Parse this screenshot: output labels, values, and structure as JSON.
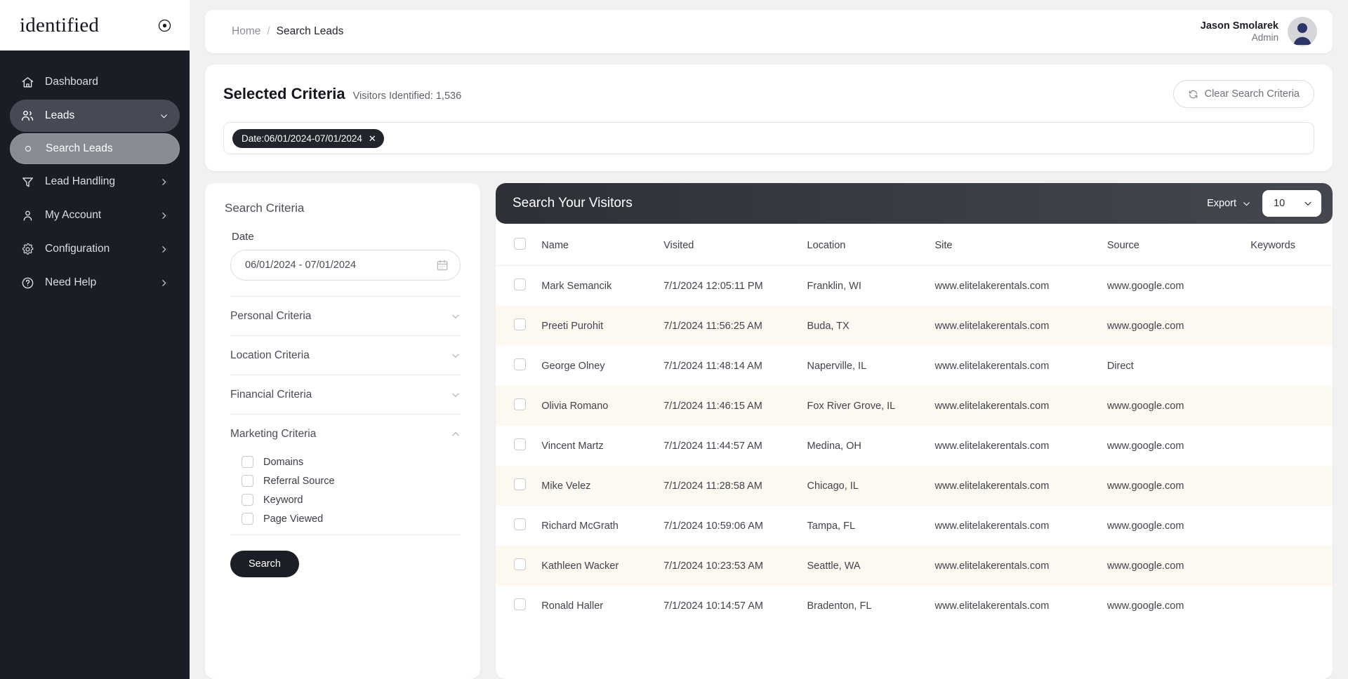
{
  "brand": {
    "name": "identified",
    "mark_icon": "circle-dot-icon"
  },
  "sidebar": {
    "items": [
      {
        "label": "Dashboard",
        "icon": "home-icon",
        "state": "default",
        "chevron": ""
      },
      {
        "label": "Leads",
        "icon": "users-icon",
        "state": "active-parent",
        "chevron": "chevron-down-icon"
      },
      {
        "label": "Search Leads",
        "icon": "bullet-icon",
        "state": "active-child",
        "chevron": ""
      },
      {
        "label": "Lead Handling",
        "icon": "funnel-icon",
        "state": "default",
        "chevron": "chevron-right-icon"
      },
      {
        "label": "My Account",
        "icon": "user-icon",
        "state": "default",
        "chevron": "chevron-right-icon"
      },
      {
        "label": "Configuration",
        "icon": "gear-icon",
        "state": "default",
        "chevron": "chevron-right-icon"
      },
      {
        "label": "Need Help",
        "icon": "help-circle-icon",
        "state": "default",
        "chevron": "chevron-right-icon"
      }
    ]
  },
  "topbar": {
    "breadcrumb_home": "Home",
    "breadcrumb_sep": "/",
    "breadcrumb_current": "Search Leads",
    "user_name": "Jason Smolarek",
    "user_role": "Admin"
  },
  "criteria": {
    "title": "Selected Criteria",
    "subtitle": "Visitors Identified: 1,536",
    "clear_button": "Clear Search Criteria",
    "clear_icon": "refresh-icon",
    "tags": [
      {
        "label": "Date:06/01/2024-07/01/2024",
        "remove_icon": "close-icon"
      }
    ]
  },
  "search_panel": {
    "title": "Search Criteria",
    "date_label": "Date",
    "date_value": "06/01/2024 - 07/01/2024",
    "date_placeholder": "Select date range",
    "calendar_icon": "calendar-icon",
    "sections": [
      {
        "label": "Personal Criteria",
        "expanded": false
      },
      {
        "label": "Location Criteria",
        "expanded": false
      },
      {
        "label": "Financial Criteria",
        "expanded": false
      },
      {
        "label": "Marketing Criteria",
        "expanded": true
      }
    ],
    "marketing_options": [
      {
        "label": "Domains",
        "checked": false
      },
      {
        "label": "Referral Source",
        "checked": false
      },
      {
        "label": "Keyword",
        "checked": false
      },
      {
        "label": "Page Viewed",
        "checked": false
      }
    ],
    "search_button": "Search"
  },
  "table": {
    "title": "Search Your Visitors",
    "export_label": "Export",
    "page_size": "10",
    "columns": [
      "Name",
      "Visited",
      "Location",
      "Site",
      "Source",
      "Keywords"
    ],
    "rows": [
      {
        "name": "Mark Semancik",
        "visited": "7/1/2024 12:05:11 PM",
        "location": "Franklin, WI",
        "site": "www.elitelakerentals.com",
        "source": "www.google.com",
        "keywords": ""
      },
      {
        "name": "Preeti Purohit",
        "visited": "7/1/2024 11:56:25 AM",
        "location": "Buda, TX",
        "site": "www.elitelakerentals.com",
        "source": "www.google.com",
        "keywords": ""
      },
      {
        "name": "George Olney",
        "visited": "7/1/2024 11:48:14 AM",
        "location": "Naperville, IL",
        "site": "www.elitelakerentals.com",
        "source": "Direct",
        "keywords": ""
      },
      {
        "name": "Olivia Romano",
        "visited": "7/1/2024 11:46:15 AM",
        "location": "Fox River Grove, IL",
        "site": "www.elitelakerentals.com",
        "source": "www.google.com",
        "keywords": ""
      },
      {
        "name": "Vincent Martz",
        "visited": "7/1/2024 11:44:57 AM",
        "location": "Medina, OH",
        "site": "www.elitelakerentals.com",
        "source": "www.google.com",
        "keywords": ""
      },
      {
        "name": "Mike Velez",
        "visited": "7/1/2024 11:28:58 AM",
        "location": "Chicago, IL",
        "site": "www.elitelakerentals.com",
        "source": "www.google.com",
        "keywords": ""
      },
      {
        "name": "Richard McGrath",
        "visited": "7/1/2024 10:59:06 AM",
        "location": "Tampa, FL",
        "site": "www.elitelakerentals.com",
        "source": "www.google.com",
        "keywords": ""
      },
      {
        "name": "Kathleen Wacker",
        "visited": "7/1/2024 10:23:53 AM",
        "location": "Seattle, WA",
        "site": "www.elitelakerentals.com",
        "source": "www.google.com",
        "keywords": ""
      },
      {
        "name": "Ronald Haller",
        "visited": "7/1/2024 10:14:57 AM",
        "location": "Bradenton, FL",
        "site": "www.elitelakerentals.com",
        "source": "www.google.com",
        "keywords": ""
      }
    ]
  },
  "colors": {
    "sidebar_bg": "#1b1d26",
    "sidebar_active_parent": "#474a55",
    "sidebar_active_child": "#888b93",
    "page_bg": "#f1f1f2",
    "dark_accent": "#22242c",
    "row_stripe": "#fdf8f0"
  }
}
